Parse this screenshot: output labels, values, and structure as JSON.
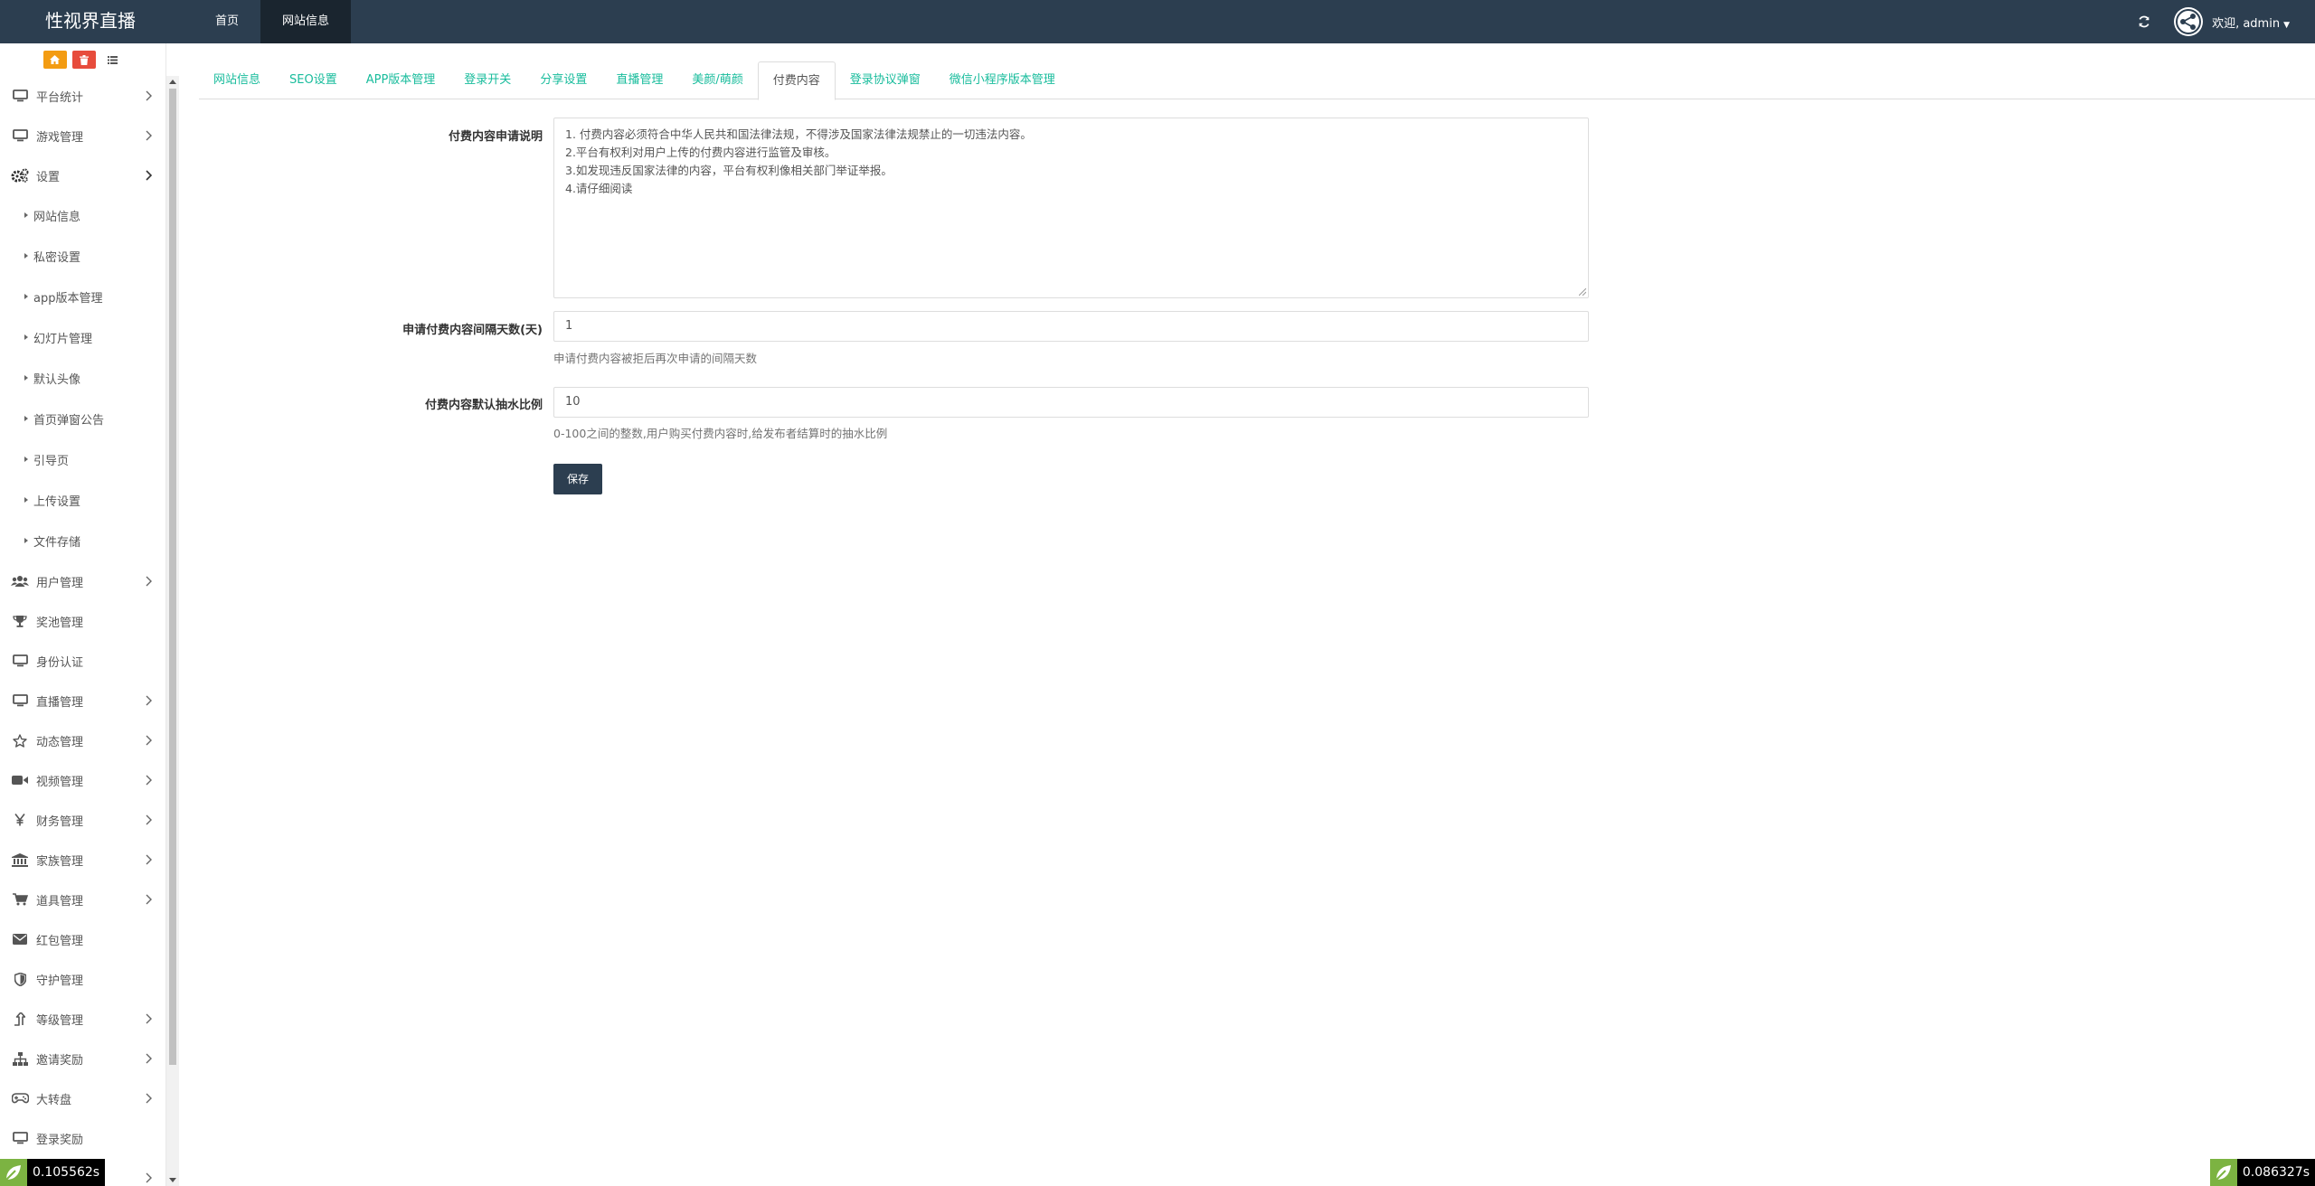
{
  "app": {
    "title": "性视界直播"
  },
  "topnav": {
    "items": [
      {
        "label": "首页"
      },
      {
        "label": "网站信息"
      }
    ],
    "welcome": "欢迎, admin"
  },
  "sidebar": {
    "shortcuts": [
      "home-icon",
      "trash-icon",
      "list-icon"
    ],
    "items": [
      {
        "label": "平台统计",
        "icon": "monitor-icon",
        "has_arrow": true
      },
      {
        "label": "游戏管理",
        "icon": "monitor-icon",
        "has_arrow": true
      },
      {
        "label": "设置",
        "icon": "gears-icon",
        "has_arrow": true,
        "expanded": true
      },
      {
        "label": "用户管理",
        "icon": "users-icon",
        "has_arrow": true
      },
      {
        "label": "奖池管理",
        "icon": "trophy-icon",
        "has_arrow": false
      },
      {
        "label": "身份认证",
        "icon": "monitor-icon",
        "has_arrow": false
      },
      {
        "label": "直播管理",
        "icon": "monitor-icon",
        "has_arrow": true
      },
      {
        "label": "动态管理",
        "icon": "star-icon",
        "has_arrow": true
      },
      {
        "label": "视频管理",
        "icon": "video-icon",
        "has_arrow": true
      },
      {
        "label": "财务管理",
        "icon": "yen-icon",
        "has_arrow": true
      },
      {
        "label": "家族管理",
        "icon": "bank-icon",
        "has_arrow": true
      },
      {
        "label": "道具管理",
        "icon": "cart-icon",
        "has_arrow": true
      },
      {
        "label": "红包管理",
        "icon": "envelope-icon",
        "has_arrow": false
      },
      {
        "label": "守护管理",
        "icon": "shield-icon",
        "has_arrow": false
      },
      {
        "label": "等级管理",
        "icon": "level-up-icon",
        "has_arrow": true
      },
      {
        "label": "邀请奖励",
        "icon": "sitemap-icon",
        "has_arrow": true
      },
      {
        "label": "大转盘",
        "icon": "gamepad-icon",
        "has_arrow": true
      },
      {
        "label": "登录奖励",
        "icon": "monitor-icon",
        "has_arrow": false
      }
    ],
    "sub_items": [
      {
        "label": "网站信息"
      },
      {
        "label": "私密设置"
      },
      {
        "label": "app版本管理"
      },
      {
        "label": "幻灯片管理"
      },
      {
        "label": "默认头像"
      },
      {
        "label": "首页弹窗公告"
      },
      {
        "label": "引导页"
      },
      {
        "label": "上传设置"
      },
      {
        "label": "文件存储"
      }
    ]
  },
  "tabs": [
    {
      "label": "网站信息"
    },
    {
      "label": "SEO设置"
    },
    {
      "label": "APP版本管理"
    },
    {
      "label": "登录开关"
    },
    {
      "label": "分享设置"
    },
    {
      "label": "直播管理"
    },
    {
      "label": "美颜/萌颜"
    },
    {
      "label": "付费内容",
      "active": true
    },
    {
      "label": "登录协议弹窗"
    },
    {
      "label": "微信小程序版本管理"
    }
  ],
  "form": {
    "description": {
      "label": "付费内容申请说明",
      "lines": [
        "1. 付费内容必须符合中华人民共和国法律法规，不得涉及国家法律法规禁止的一切违法内容。",
        "2.平台有权利对用户上传的付费内容进行监管及审核。",
        "3.如发现违反国家法律的内容，平台有权利像相关部门举证举报。",
        "4.请仔细阅读"
      ]
    },
    "interval": {
      "label": "申请付费内容间隔天数(天)",
      "value": "1",
      "help": "申请付费内容被拒后再次申请的间隔天数"
    },
    "commission": {
      "label": "付费内容默认抽水比例",
      "value": "10",
      "help": "0-100之间的整数,用户购买付费内容时,给发布者结算时的抽水比例"
    },
    "save_label": "保存"
  },
  "timers": {
    "left": "0.105562s",
    "right": "0.086327s"
  },
  "colors": {
    "navbar": "#2c3e50",
    "accent": "#18bc9c",
    "shortcut_orange": "#f39c12",
    "shortcut_red": "#e74c3c"
  }
}
